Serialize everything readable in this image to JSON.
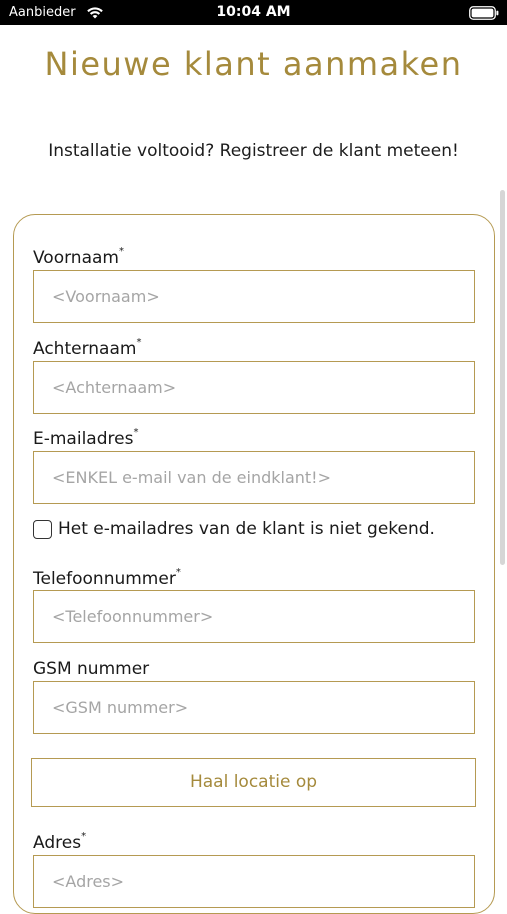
{
  "status_bar": {
    "carrier": "Aanbieder",
    "time": "10:04 AM",
    "icons": [
      "wifi-icon",
      "battery-icon"
    ]
  },
  "header": {
    "title": "Nieuwe klant aanmaken",
    "subtitle": "Installatie voltooid? Registreer de klant meteen!"
  },
  "form": {
    "first_name": {
      "label": "Voornaam",
      "required_mark": "*",
      "value": "",
      "placeholder": "<Voornaam>"
    },
    "last_name": {
      "label": "Achternaam",
      "required_mark": "*",
      "value": "",
      "placeholder": "<Achternaam>"
    },
    "email": {
      "label": "E-mailadres",
      "required_mark": "*",
      "value": "",
      "placeholder": "<ENKEL e-mail van de eindklant!>"
    },
    "email_unknown_checkbox": {
      "label": "Het e-mailadres van de klant is niet gekend.",
      "checked": false
    },
    "phone": {
      "label": "Telefoonnummer",
      "required_mark": "*",
      "value": "",
      "placeholder": "<Telefoonnummer>"
    },
    "mobile": {
      "label": "GSM nummer",
      "value": "",
      "placeholder": "<GSM nummer>"
    },
    "location_button": {
      "label": "Haal locatie op"
    },
    "address": {
      "label": "Adres",
      "required_mark": "*",
      "value": "",
      "placeholder": "<Adres>"
    }
  },
  "colors": {
    "accent": "#a58a3c",
    "border": "#b59a52",
    "placeholder": "#a5a5a5",
    "status_bar_bg": "#000000"
  }
}
